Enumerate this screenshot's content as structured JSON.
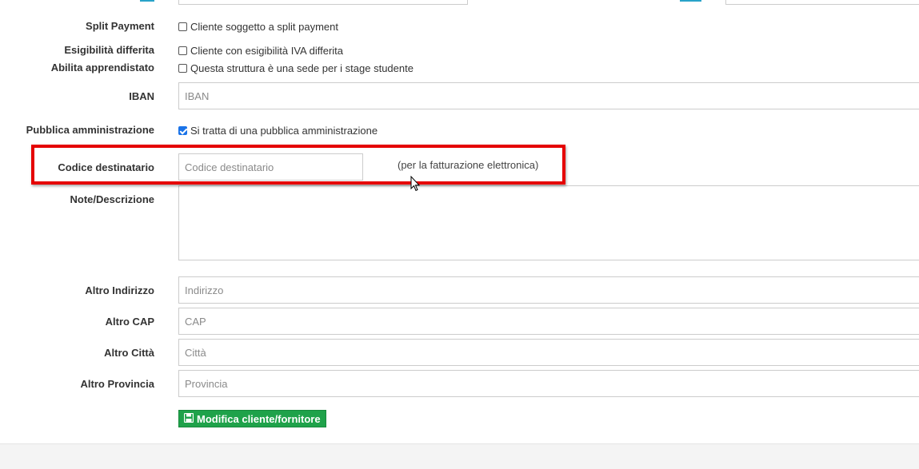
{
  "form": {
    "split_payment": {
      "label": "Split Payment",
      "checkbox_text": "Cliente soggetto a split payment",
      "checked": false
    },
    "esigibilita": {
      "label": "Esigibilità differita",
      "checkbox_text": "Cliente con esigibilità IVA differita",
      "checked": false
    },
    "apprendistato": {
      "label": "Abilita apprendistato",
      "checkbox_text": "Questa struttura è una sede per i stage studente",
      "checked": false
    },
    "iban": {
      "label": "IBAN",
      "placeholder": "IBAN"
    },
    "pa": {
      "label": "Pubblica amministrazione",
      "checkbox_text": "Si tratta di una pubblica amministrazione",
      "checked": true
    },
    "codice_destinatario": {
      "label": "Codice destinatario",
      "placeholder": "Codice destinatario",
      "hint": "(per la fatturazione elettronica)"
    },
    "note": {
      "label": "Note/Descrizione"
    },
    "altro_indirizzo": {
      "label": "Altro Indirizzo",
      "placeholder": "Indirizzo"
    },
    "altro_cap": {
      "label": "Altro CAP",
      "placeholder": "CAP"
    },
    "altro_citta": {
      "label": "Altro Città",
      "placeholder": "Città"
    },
    "altro_provincia": {
      "label": "Altro Provincia",
      "placeholder": "Provincia"
    },
    "submit_label": "Modifica cliente/fornitore"
  },
  "colors": {
    "highlight": "#e50000",
    "button": "#1fa24a",
    "checkbox_checked": "#1a73e8"
  },
  "icons": {
    "save": "floppy-disk-icon"
  }
}
